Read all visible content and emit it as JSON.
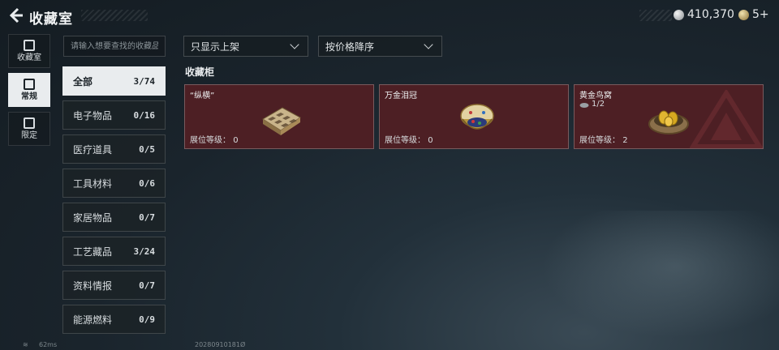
{
  "header": {
    "back_icon": "chevron-left-icon",
    "title": "收藏室",
    "currencies": [
      {
        "icon": "silver-coin-icon",
        "value": "410,370"
      },
      {
        "icon": "gold-coin-icon",
        "value": "5+"
      }
    ]
  },
  "nav": {
    "items": [
      {
        "label": "收藏室",
        "icon": "collection-room-icon",
        "active": false
      },
      {
        "label": "常规",
        "icon": "regular-icon",
        "active": true
      },
      {
        "label": "限定",
        "icon": "limited-icon",
        "active": false
      }
    ]
  },
  "search": {
    "placeholder": "请输入想要查找的收藏品"
  },
  "categories": [
    {
      "label": "全部",
      "count": "3/74"
    },
    {
      "label": "电子物品",
      "count": "0/16"
    },
    {
      "label": "医疗道具",
      "count": "0/5"
    },
    {
      "label": "工具材料",
      "count": "0/6"
    },
    {
      "label": "家居物品",
      "count": "0/7"
    },
    {
      "label": "工艺藏品",
      "count": "3/24"
    },
    {
      "label": "资料情报",
      "count": "0/7"
    },
    {
      "label": "能源燃料",
      "count": "0/9"
    }
  ],
  "filters": {
    "shelf_filter": "只显示上架",
    "sort": "按价格降序"
  },
  "section_title": "收藏柜",
  "cards": [
    {
      "name": "“纵横”",
      "level_label": "展位等级：",
      "level": "0",
      "art": "chessboard-icon"
    },
    {
      "name": "万金泪冠",
      "level_label": "展位等级：",
      "level": "0",
      "art": "jeweled-egg-icon"
    },
    {
      "name": "黄金鸟窝",
      "sub": "1/2",
      "level_label": "展位等级：",
      "level": "2",
      "art": "golden-nest-icon"
    }
  ],
  "footer": {
    "ping": "62ms",
    "build": "20280910181Ø"
  },
  "colors": {
    "card_bg": "#4d1f24",
    "active_bg": "#e9ecee"
  }
}
